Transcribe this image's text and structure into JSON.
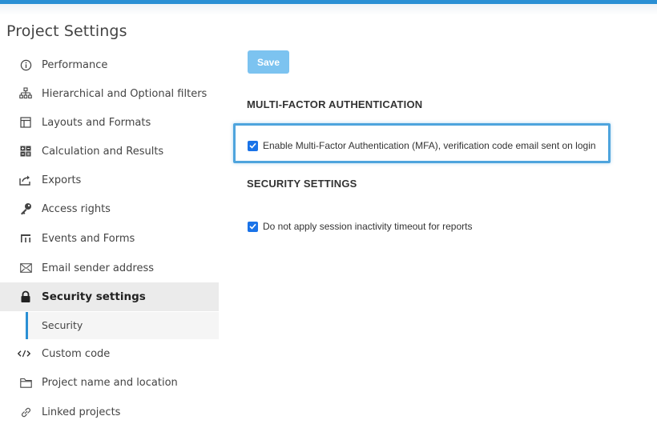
{
  "app": {
    "title": "Project Settings"
  },
  "sidebar": {
    "items": [
      {
        "label": "Performance",
        "icon": "info-circle-icon"
      },
      {
        "label": "Hierarchical and Optional filters",
        "icon": "hierarchy-icon"
      },
      {
        "label": "Layouts and Formats",
        "icon": "layout-icon"
      },
      {
        "label": "Calculation and Results",
        "icon": "calculator-icon"
      },
      {
        "label": "Exports",
        "icon": "export-icon"
      },
      {
        "label": "Access rights",
        "icon": "key-icon"
      },
      {
        "label": "Events and Forms",
        "icon": "form-icon"
      },
      {
        "label": "Email sender address",
        "icon": "envelope-icon"
      },
      {
        "label": "Security settings",
        "icon": "lock-icon",
        "active": true
      },
      {
        "label": "Custom code",
        "icon": "code-icon"
      },
      {
        "label": "Project name and location",
        "icon": "folder-icon"
      },
      {
        "label": "Linked projects",
        "icon": "link-icon"
      }
    ],
    "sub_item": {
      "label": "Security",
      "parent": "Security settings"
    }
  },
  "main": {
    "save_label": "Save",
    "mfa_section": {
      "title": "MULTI-FACTOR AUTHENTICATION",
      "checkbox_label": "Enable Multi-Factor Authentication (MFA), verification code email sent on login",
      "checked": true
    },
    "security_section": {
      "title": "SECURITY SETTINGS",
      "checkbox_label": "Do not apply session inactivity timeout for reports",
      "checked": true
    }
  },
  "colors": {
    "accent": "#2a8fd4",
    "save_button": "#7cc3f0",
    "checkbox": "#1a73e8",
    "active_item_bg": "#ebebeb"
  }
}
